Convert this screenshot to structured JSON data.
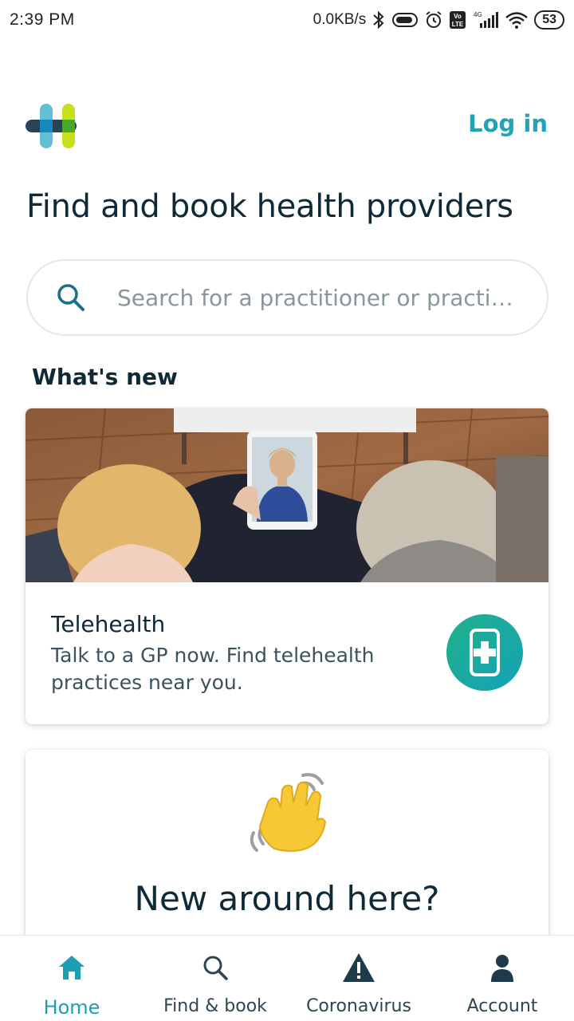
{
  "status_bar": {
    "time": "2:39 PM",
    "network_speed": "0.0KB/s",
    "battery": "53",
    "icons": [
      "bluetooth-icon",
      "vibrate-icon",
      "alarm-icon",
      "volte-icon",
      "signal-4g-icon",
      "wifi-icon",
      "battery-icon"
    ]
  },
  "header": {
    "logo_icon": "healthengine-logo-icon",
    "login_label": "Log in"
  },
  "page_title": "Find and book health providers",
  "search": {
    "placeholder": "Search for a practitioner or practi…",
    "icon": "search-icon"
  },
  "whats_new": {
    "title": "What's new",
    "cards": [
      {
        "title": "Telehealth",
        "description": "Talk to a GP now. Find telehealth practices near you.",
        "icon": "phone-medical-icon"
      },
      {
        "icon": "waving-hand-icon",
        "title": "New around here?"
      }
    ]
  },
  "bottom_nav": {
    "items": [
      {
        "label": "Home",
        "icon": "home-icon",
        "active": true
      },
      {
        "label": "Find & book",
        "icon": "search-icon",
        "active": false
      },
      {
        "label": "Coronavirus",
        "icon": "warning-icon",
        "active": false
      },
      {
        "label": "Account",
        "icon": "account-icon",
        "active": false
      }
    ]
  },
  "colors": {
    "accent": "#1fa4b6",
    "text_dark": "#0f2a36",
    "telehealth_gradient_start": "#20b08a",
    "telehealth_gradient_end": "#14a3b7"
  }
}
